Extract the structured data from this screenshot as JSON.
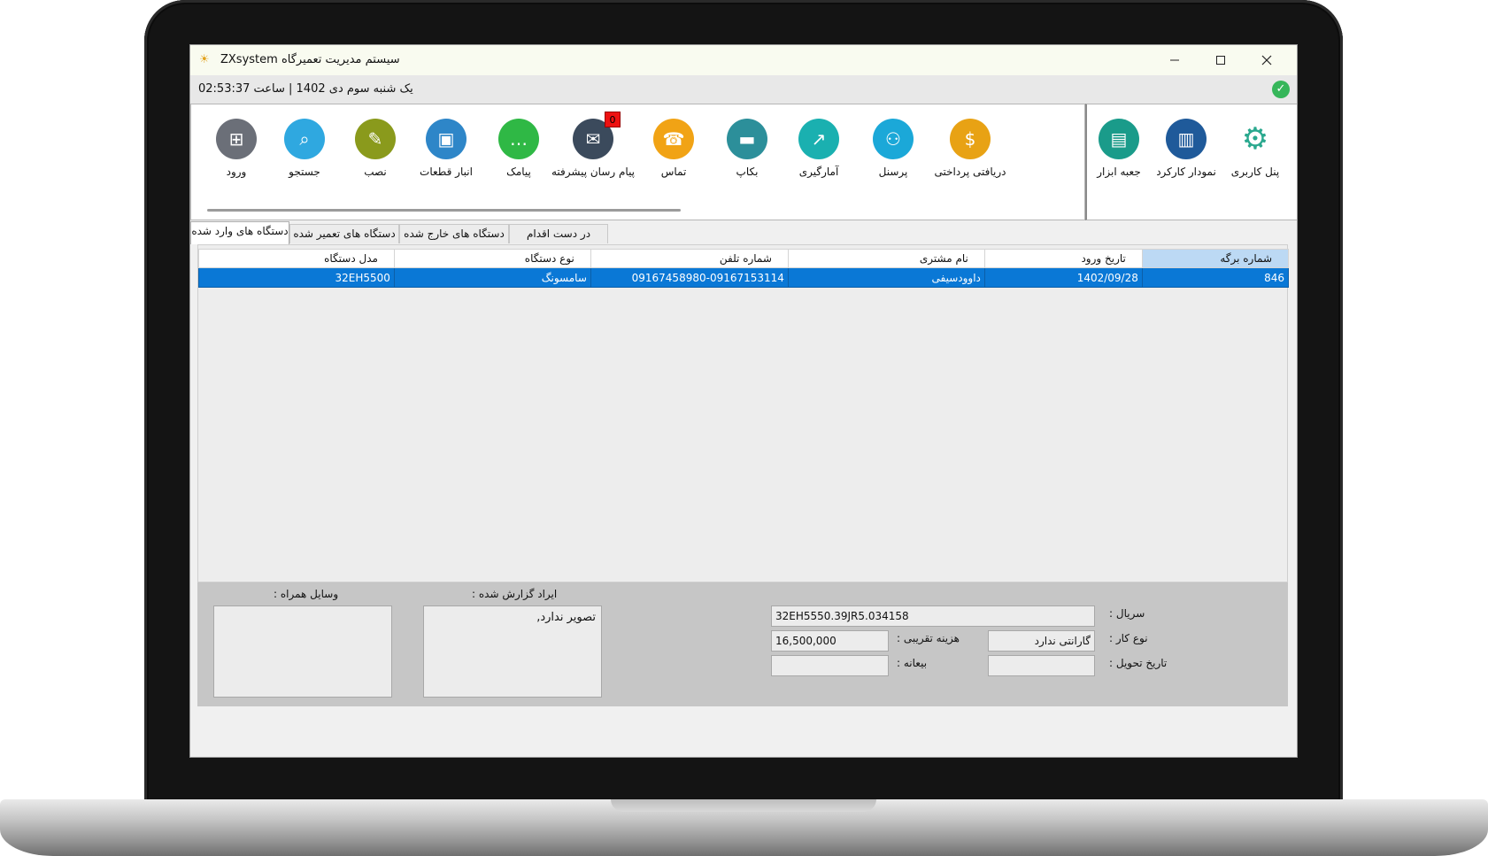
{
  "window": {
    "title": "ZXsystem سیستم مدیریت تعمیرگاه",
    "status": "یک شنبه سوم دی 1402 | ساعت 02:53:37"
  },
  "toolbar": {
    "items": [
      {
        "label": "ورود",
        "icon": "login-icon",
        "color": "#6b6f78"
      },
      {
        "label": "جستجو",
        "icon": "search-document-icon",
        "color": "#2fa8e0"
      },
      {
        "label": "نصب",
        "icon": "toolbox-wrench-icon",
        "color": "#8a9a1c"
      },
      {
        "label": "انبار قطعات",
        "icon": "chip-icon",
        "color": "#2e86c8"
      },
      {
        "label": "پیامک",
        "icon": "sms-bubble-icon",
        "color": "#2fb845"
      },
      {
        "label": "پیام رسان پیشرفته",
        "icon": "sms-envelope-icon",
        "color": "#3b4a5c",
        "badge": "0"
      },
      {
        "label": "تماس",
        "icon": "phone-icon",
        "color": "#f1a315"
      },
      {
        "label": "بکاپ",
        "icon": "usb-drive-icon",
        "color": "#2c8f9a"
      },
      {
        "label": "آمارگیری",
        "icon": "stats-chart-icon",
        "color": "#1ab0b0"
      },
      {
        "label": "پرسنل",
        "icon": "personnel-icon",
        "color": "#1ba8d8"
      },
      {
        "label": "دریافتی پرداختی",
        "icon": "dollar-coin-icon",
        "color": "#e8a214"
      }
    ],
    "side_items": [
      {
        "label": "جعبه ابزار",
        "icon": "toolbox-icon",
        "color": "#1a9b8a"
      },
      {
        "label": "نمودار کارکرد",
        "icon": "bar-chart-icon",
        "color": "#1f5a9a"
      },
      {
        "label": "پنل کاربری",
        "icon": "gears-icon",
        "color": "#2aa88e"
      }
    ]
  },
  "tabs": [
    "دستگاه های وارد شده",
    "دستگاه های تعمیر شده",
    "دستگاه های خارج شده",
    "در دست اقدام"
  ],
  "grid": {
    "columns": [
      "شماره برگه",
      "تاریخ ورود",
      "نام مشتری",
      "شماره تلفن",
      "نوع دستگاه",
      "مدل دستگاه"
    ],
    "rows": [
      [
        "846",
        "1402/09/28",
        "داوودسیفی",
        "09167458980-09167153114",
        "سامسونگ",
        "32EH5500"
      ]
    ]
  },
  "details": {
    "serial_label": "سریال :",
    "serial_value": "32EH5550.39JR5.034158",
    "work_type_label": "نوع کار :",
    "work_type_value": "گارانتی ندارد",
    "cost_label": "هزینه تقریبی :",
    "cost_value": "16,500,000",
    "delivery_label": "تاریخ تحویل :",
    "delivery_value": "",
    "deposit_label": "بیعانه :",
    "deposit_value": "",
    "reported_issue_label": "ایراد گزارش شده :",
    "reported_issue_value": "تصویر ندارد,",
    "accessories_label": "وسایل همراه :",
    "accessories_value": ""
  }
}
